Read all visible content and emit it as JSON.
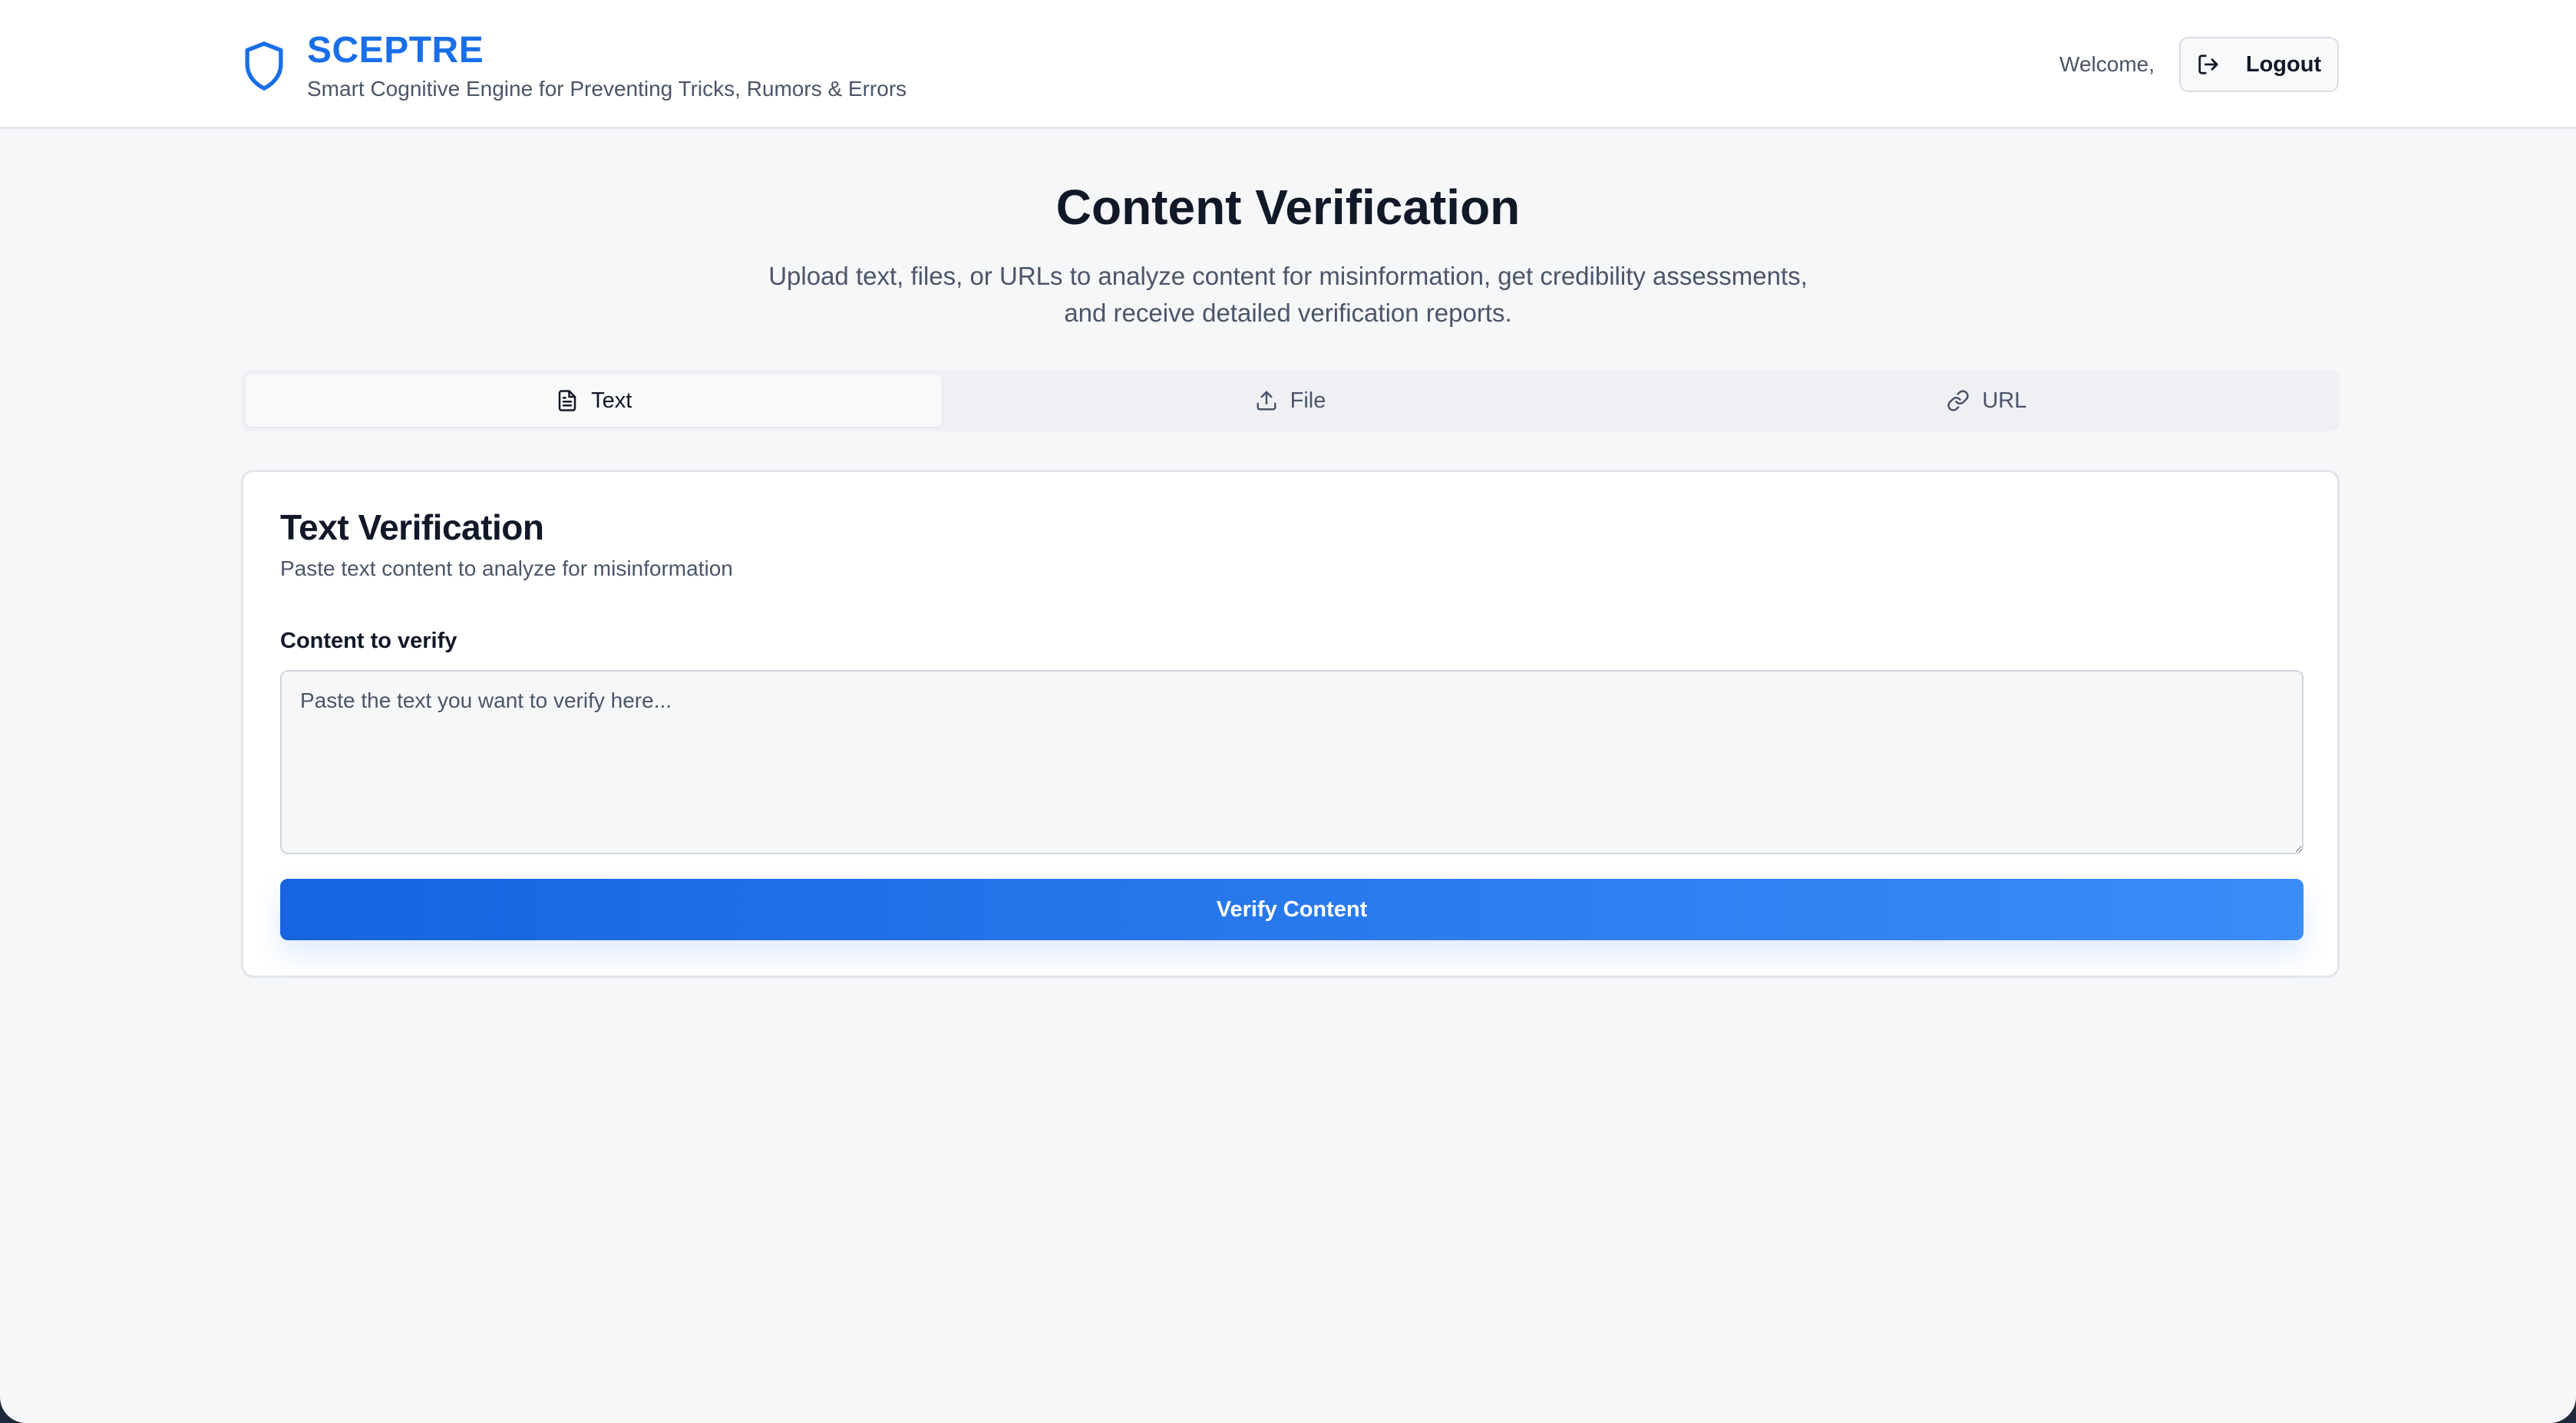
{
  "header": {
    "brand_title": "SCEPTRE",
    "brand_subtitle": "Smart Cognitive Engine for Preventing Tricks, Rumors & Errors",
    "brand_icon": "shield-icon",
    "welcome_text": "Welcome,",
    "logout_label": "Logout",
    "logout_icon": "logout-icon"
  },
  "hero": {
    "title": "Content Verification",
    "description_line1": "Upload text, files, or URLs to analyze content for misinformation, get credibility assessments,",
    "description_line2": "and receive detailed verification reports."
  },
  "tabs": [
    {
      "label": "Text",
      "icon": "file-text-icon",
      "active": true
    },
    {
      "label": "File",
      "icon": "upload-icon",
      "active": false
    },
    {
      "label": "URL",
      "icon": "link-icon",
      "active": false
    }
  ],
  "card": {
    "title": "Text Verification",
    "subtitle": "Paste text content to analyze for misinformation",
    "field_label": "Content to verify",
    "textarea_value": "",
    "textarea_placeholder": "Paste the text you want to verify here...",
    "submit_label": "Verify Content"
  },
  "colors": {
    "brand": "#1a6fe8",
    "background": "#f6f7f9",
    "button_gradient_start": "#1664e0",
    "button_gradient_end": "#3b8cf7"
  }
}
